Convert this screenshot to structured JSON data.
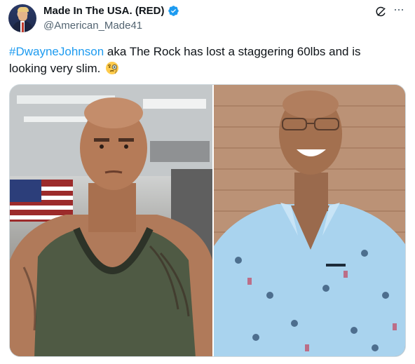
{
  "author": {
    "display_name": "Made In The USA. (RED)",
    "handle": "@American_Made41",
    "avatar": "avatar-portrait",
    "verified": true
  },
  "actions": {
    "grok_icon": "grok-icon",
    "more_icon": "more-icon",
    "more_label": "···"
  },
  "tweet": {
    "hashtag": "#DwayneJohnson",
    "text": " aka The Rock has lost a staggering 60lbs and is looking very slim.",
    "emoji": "face-with-monocle"
  },
  "media": {
    "left_photo": "man-in-green-tank-top-gym",
    "right_photo": "smiling-man-blue-printed-shirt"
  },
  "colors": {
    "link": "#1d9bf0",
    "verified": "#1d9bf0",
    "secondary_text": "#536471",
    "text": "#0f1419"
  }
}
